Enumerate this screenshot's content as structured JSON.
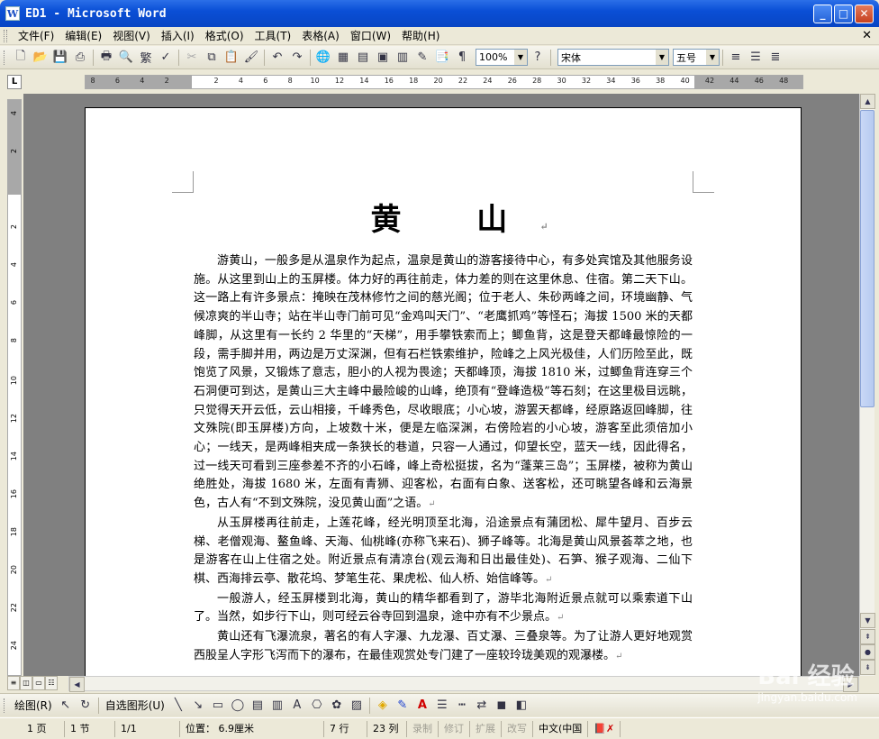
{
  "window": {
    "title": "ED1 - Microsoft Word",
    "app_icon": "W"
  },
  "menu": [
    "文件(F)",
    "编辑(E)",
    "视图(V)",
    "插入(I)",
    "格式(O)",
    "工具(T)",
    "表格(A)",
    "窗口(W)",
    "帮助(H)"
  ],
  "toolbar": {
    "zoom": "100%",
    "font": "宋体",
    "font_size": "五号",
    "traditional_label": "繁"
  },
  "ruler": {
    "h_ticks": [
      "8",
      "6",
      "4",
      "2",
      "",
      "2",
      "4",
      "6",
      "8",
      "10",
      "12",
      "14",
      "16",
      "18",
      "20",
      "22",
      "24",
      "26",
      "28",
      "30",
      "32",
      "34",
      "36",
      "38",
      "40",
      "42",
      "44",
      "46",
      "48"
    ],
    "v_ticks": [
      "4",
      "2",
      "",
      "2",
      "4",
      "6",
      "8",
      "10",
      "12",
      "14",
      "16",
      "18",
      "20",
      "22",
      "24"
    ]
  },
  "document": {
    "title": "黄 山",
    "paragraphs": [
      "游黄山，一般多是从温泉作为起点，温泉是黄山的游客接待中心，有多处宾馆及其他服务设施。从这里到山上的玉屏楼。体力好的再往前走，体力差的则在这里休息、住宿。第二天下山。这一路上有许多景点：掩映在茂林修竹之间的慈光阁；位于老人、朱砂两峰之间，环境幽静、气候凉爽的半山寺；站在半山寺门前可见“金鸡叫天门”、“老鹰抓鸡”等怪石；海拔 1500 米的天都峰脚，从这里有一长约 2 华里的“天梯”，用手攀铁索而上；鲫鱼背，这是登天都峰最惊险的一段，需手脚并用，两边是万丈深渊，但有石栏铁索维护，险峰之上风光极佳，人们历险至此，既饱览了风景，又锻炼了意志，胆小的人视为畏途；天都峰顶，海拔 1810 米，过鲫鱼背连穿三个石洞便可到达，是黄山三大主峰中最险峻的山峰，绝顶有“登峰造极”等石刻；在这里极目远眺，只觉得天开云低，云山相接，千峰秀色，尽收眼底；小心坡，游罢天都峰，经原路返回峰脚，往文殊院(即玉屏楼)方向，上坡数十米，便是左临深渊，右傍险岩的小心坡，游客至此须倍加小心；一线天，是两峰相夹成一条狭长的巷道，只容一人通过，仰望长空，蓝天一线，因此得名，过一线天可看到三座参差不齐的小石峰，峰上奇松挺拔，名为“蓬莱三岛”；玉屏楼，被称为黄山绝胜处，海拔 1680 米，左面有青狮、迎客松，右面有白象、送客松，还可眺望各峰和云海景色，古人有“不到文殊院，没见黄山面”之语。",
      "从玉屏楼再往前走，上莲花峰，经光明顶至北海，沿途景点有蒲团松、犀牛望月、百步云梯、老僧观海、鳌鱼峰、天海、仙桃峰(亦称飞来石)、狮子峰等。北海是黄山风景荟萃之地，也是游客在山上住宿之处。附近景点有清凉台(观云海和日出最佳处)、石笋、猴子观海、二仙下棋、西海排云亭、散花坞、梦笔生花、果虎松、仙人桥、始信峰等。",
      "一般游人，经玉屏楼到北海，黄山的精华都看到了，游毕北海附近景点就可以乘索道下山了。当然，如步行下山，则可经云谷寺回到温泉，途中亦有不少景点。",
      "黄山还有飞瀑流泉，著名的有人字瀑、九龙瀑、百丈瀑、三叠泉等。为了让游人更好地观赏西股呈人字形飞泻而下的瀑布，在最佳观赏处专门建了一座较玲珑美观的观瀑楼。"
    ]
  },
  "drawbar": {
    "draw_label": "绘图(R)",
    "autoshape_label": "自选图形(U)"
  },
  "status": {
    "page": "1 页",
    "section": "1 节",
    "page_of": "1/1",
    "position": "位置： 6.9厘米",
    "line": "7 行",
    "column": "23 列",
    "rec": "录制",
    "trk": "修订",
    "ext": "扩展",
    "ovr": "改写",
    "lang": "中文(中国"
  },
  "watermark": {
    "brand": "Bai 经验",
    "url": "jingyan.baidu.com"
  },
  "colors": {
    "titlebar": "#0a4fd6",
    "chrome": "#ece9d8",
    "workspace": "#808080"
  }
}
